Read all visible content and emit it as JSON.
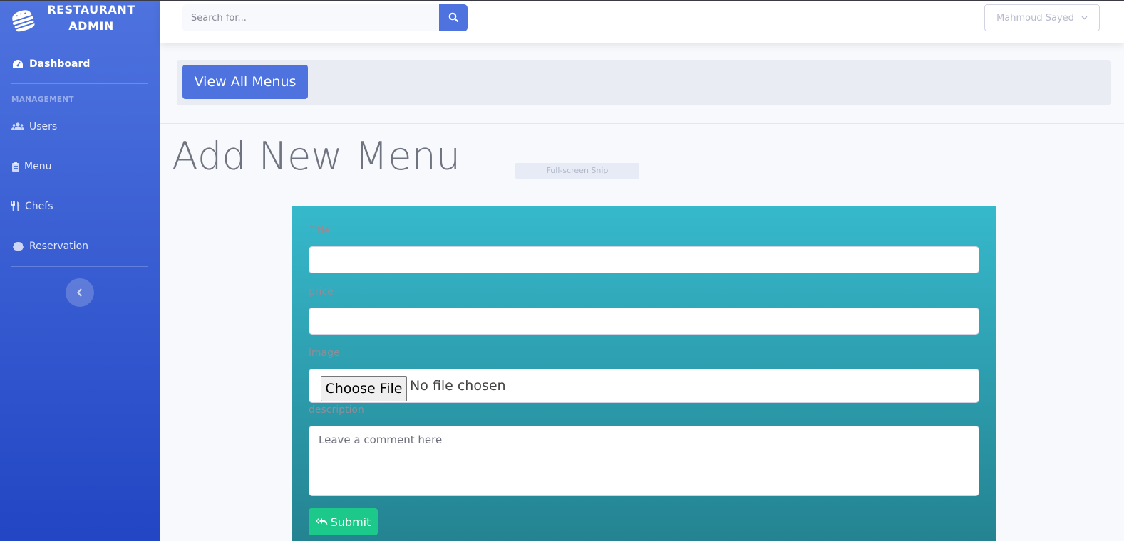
{
  "sidebar": {
    "brand_line1": "RESTAURANT",
    "brand_line2": "ADMIN",
    "brand_icon": "burger-icon",
    "dashboard_label": "Dashboard",
    "heading": "MANAGEMENT",
    "items": [
      {
        "label": "Users",
        "icon": "users-icon"
      },
      {
        "label": "Menu",
        "icon": "clipboard-icon"
      },
      {
        "label": "Chefs",
        "icon": "utensils-icon"
      },
      {
        "label": "Reservation",
        "icon": "hamburger-icon"
      }
    ],
    "toggle_icon": "chevron-left-icon"
  },
  "topbar": {
    "search_placeholder": "Search for...",
    "search_icon": "search-icon",
    "user_name": "Mahmoud Sayed",
    "user_chevron": "chevron-down-icon"
  },
  "toolbar": {
    "view_all_label": "View All Menus"
  },
  "page": {
    "title": "Add New Menu",
    "overlay_text": "Full-screen Snip"
  },
  "form": {
    "title_label": "Title",
    "price_label": "price",
    "image_label": "image",
    "choose_file_label": "Choose File",
    "no_file_text": "No file chosen",
    "description_label": "description",
    "description_placeholder": "Leave a comment here",
    "submit_label": "Submit",
    "submit_icon": "reply-all-icon"
  },
  "colors": {
    "sidebar_top": "#4e73df",
    "sidebar_bottom": "#2246c4",
    "primary": "#4e73df",
    "form_top": "#36b9cc",
    "form_bottom": "#248391",
    "success": "#1cc88a"
  }
}
